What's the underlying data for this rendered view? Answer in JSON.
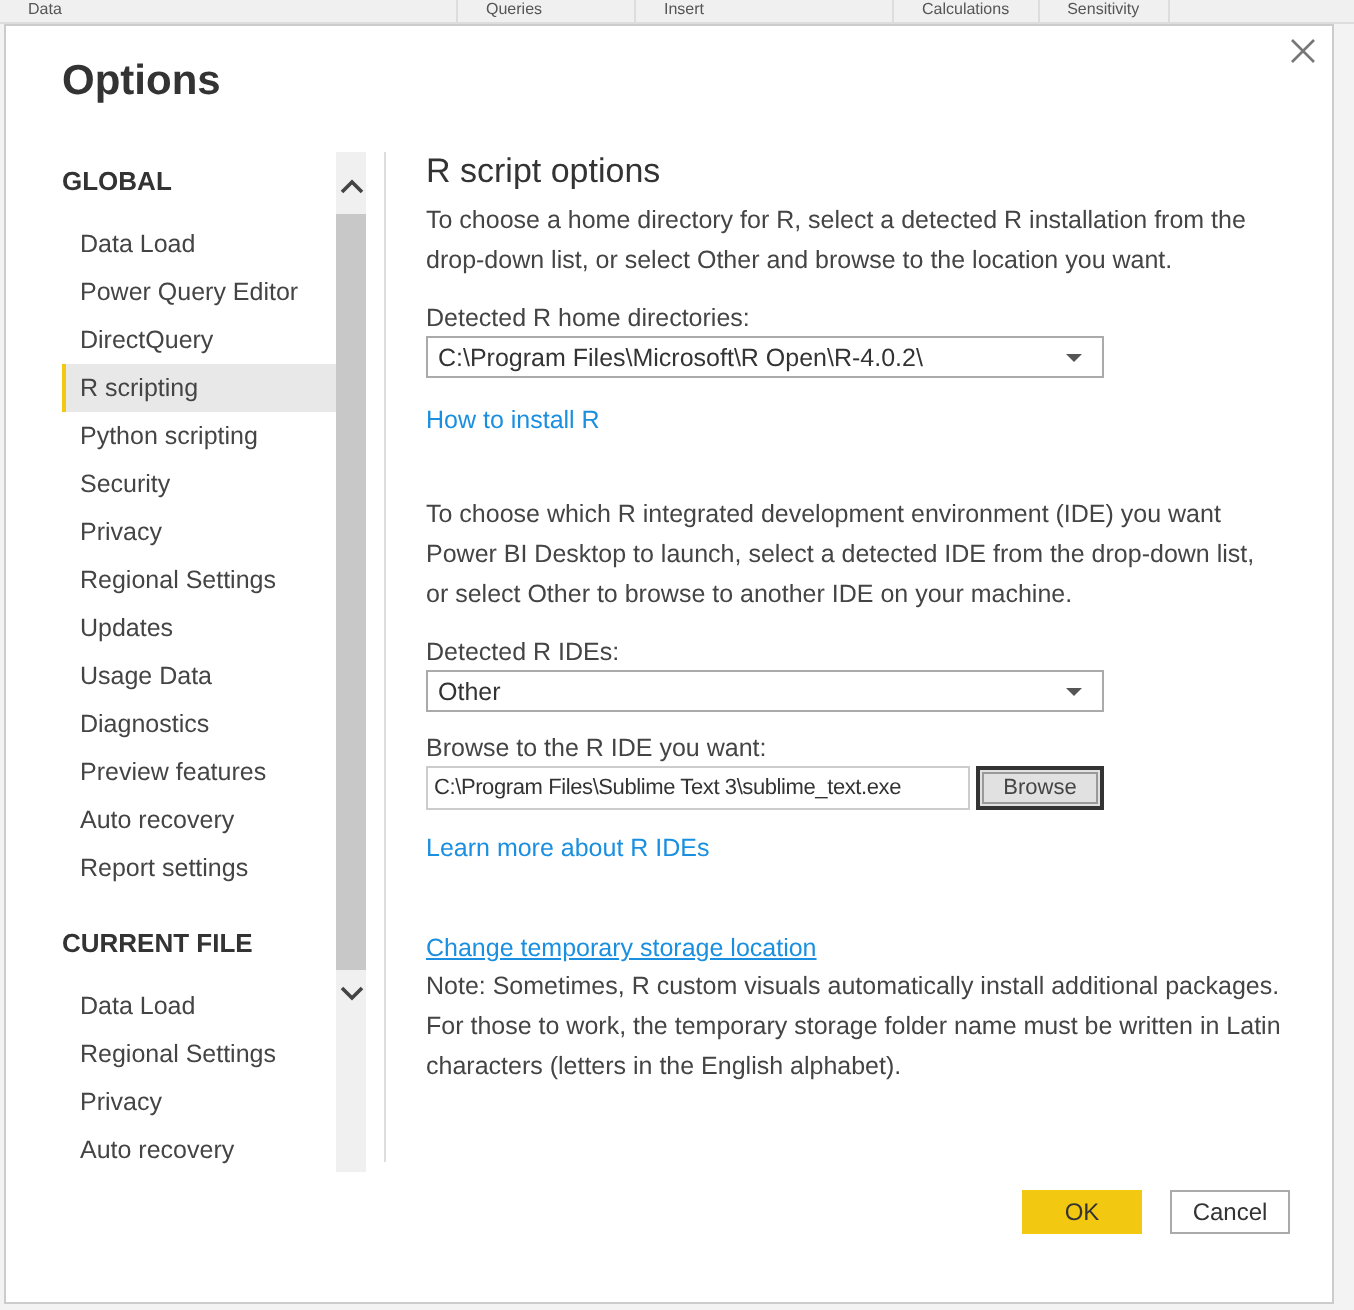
{
  "background_tabs": [
    "Data",
    "Queries",
    "Insert",
    "Calculations",
    "Sensitivity"
  ],
  "window": {
    "title": "Options"
  },
  "sidebar": {
    "sections": [
      {
        "title": "GLOBAL",
        "items": [
          {
            "label": "Data Load",
            "selected": false
          },
          {
            "label": "Power Query Editor",
            "selected": false
          },
          {
            "label": "DirectQuery",
            "selected": false
          },
          {
            "label": "R scripting",
            "selected": true
          },
          {
            "label": "Python scripting",
            "selected": false
          },
          {
            "label": "Security",
            "selected": false
          },
          {
            "label": "Privacy",
            "selected": false
          },
          {
            "label": "Regional Settings",
            "selected": false
          },
          {
            "label": "Updates",
            "selected": false
          },
          {
            "label": "Usage Data",
            "selected": false
          },
          {
            "label": "Diagnostics",
            "selected": false
          },
          {
            "label": "Preview features",
            "selected": false
          },
          {
            "label": "Auto recovery",
            "selected": false
          },
          {
            "label": "Report settings",
            "selected": false
          }
        ]
      },
      {
        "title": "CURRENT FILE",
        "items": [
          {
            "label": "Data Load",
            "selected": false
          },
          {
            "label": "Regional Settings",
            "selected": false
          },
          {
            "label": "Privacy",
            "selected": false
          },
          {
            "label": "Auto recovery",
            "selected": false
          }
        ]
      }
    ]
  },
  "content": {
    "heading": "R script options",
    "intro": "To choose a home directory for R, select a detected R installation from the drop-down list, or select Other and browse to the location you want.",
    "home_dirs": {
      "label": "Detected R home directories:",
      "value": "C:\\Program Files\\Microsoft\\R Open\\R-4.0.2\\"
    },
    "install_link": "How to install R",
    "ide_intro": "To choose which R integrated development environment (IDE) you want Power BI Desktop to launch, select a detected IDE from the drop-down list, or select Other to browse to another IDE on your machine.",
    "ides": {
      "label": "Detected R IDEs:",
      "value": "Other"
    },
    "browse": {
      "label": "Browse to the R IDE you want:",
      "value": "C:\\Program Files\\Sublime Text 3\\sublime_text.exe",
      "button": "Browse"
    },
    "ide_link": "Learn more about R IDEs",
    "storage_link": "Change temporary storage location",
    "note": "Note: Sometimes, R custom visuals automatically install additional packages. For those to work, the temporary storage folder name must be written in Latin characters (letters in the English alphabet)."
  },
  "buttons": [
    {
      "label": "OK",
      "kind": "primary"
    },
    {
      "label": "Cancel",
      "kind": "secondary"
    }
  ]
}
